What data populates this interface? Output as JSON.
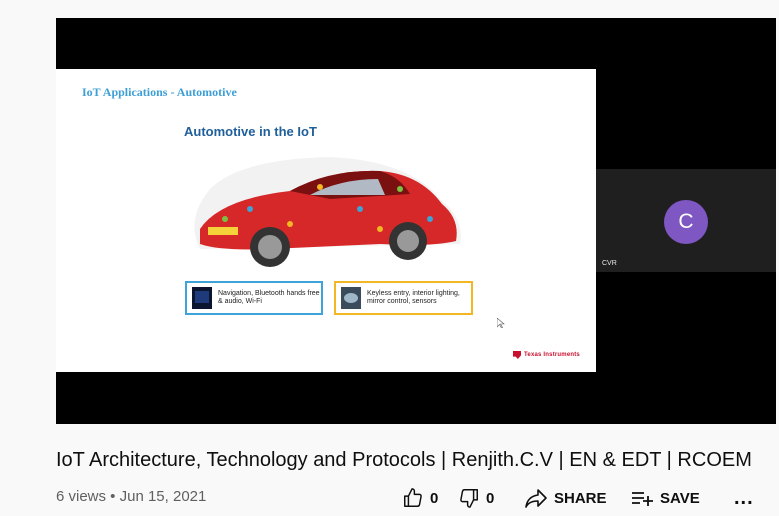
{
  "slide": {
    "title": "IoT Applications - Automotive",
    "heading": "Automotive in the IoT",
    "box_nav": "Navigation, Bluetooth hands free & audio, Wi-Fi",
    "box_key": "Keyless entry, interior lighting, mirror control, sensors",
    "logo_text": "Texas Instruments"
  },
  "participant": {
    "initial": "C",
    "name": "CVR",
    "avatar_color": "#7e57c2"
  },
  "video": {
    "title": "IoT Architecture, Technology and Protocols | Renjith.C.V | EN & EDT | RCOEM",
    "meta": "6 views • Jun 15, 2021",
    "likes": "0",
    "dislikes": "0",
    "share_label": "SHARE",
    "save_label": "SAVE",
    "more_label": "..."
  },
  "icons": {
    "like": "thumbs-up-icon",
    "dislike": "thumbs-down-icon",
    "share": "share-arrow-icon",
    "save": "add-to-playlist-icon",
    "more": "more-horizontal-icon"
  }
}
